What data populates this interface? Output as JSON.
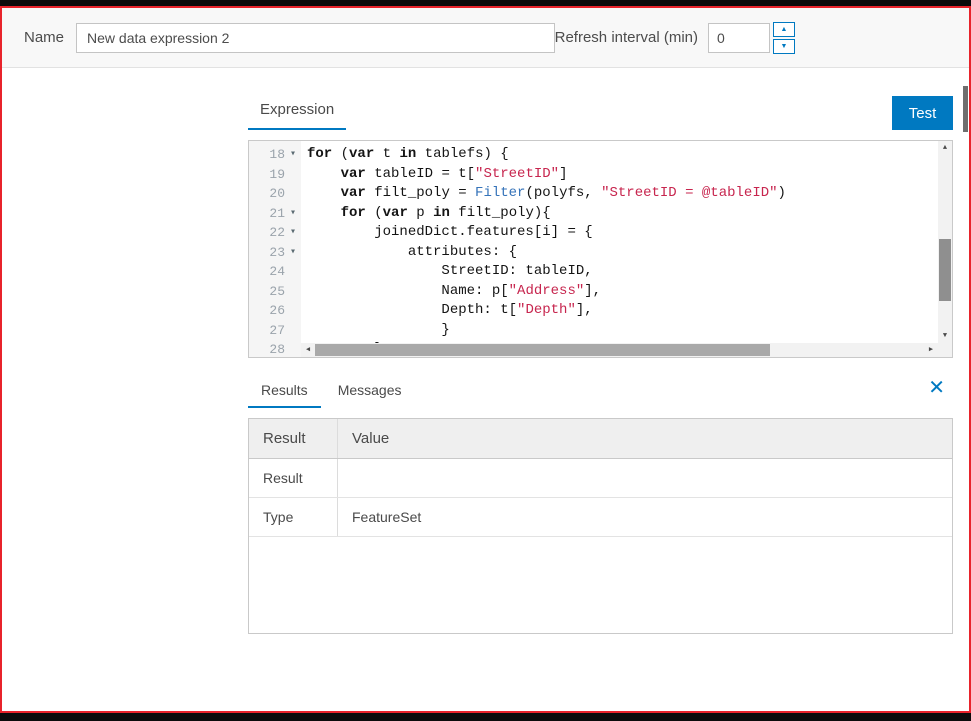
{
  "colors": {
    "accent": "#0079c1",
    "frame_border": "#e8232b",
    "code_string": "#c7254e",
    "code_function": "#3573b9"
  },
  "icons": {
    "fold": "▾",
    "scroll_up": "▲",
    "scroll_down": "▼",
    "scroll_left": "◀",
    "scroll_right": "▶",
    "spinner_up": "▲",
    "spinner_down": "▼",
    "close": "✕"
  },
  "header": {
    "name_label": "Name",
    "name_value": "New data expression 2",
    "refresh_label": "Refresh interval (min)",
    "refresh_value": "0"
  },
  "expression_panel": {
    "tab": "Expression",
    "test_button": "Test",
    "editor": {
      "first_line_number": 18,
      "lines": [
        {
          "num": 18,
          "fold": true,
          "segs": [
            [
              "k",
              "for"
            ],
            [
              "p",
              " ("
            ],
            [
              "k",
              "var"
            ],
            [
              "p",
              " t "
            ],
            [
              "k",
              "in"
            ],
            [
              "p",
              " tablefs) {"
            ]
          ]
        },
        {
          "num": 19,
          "fold": false,
          "segs": [
            [
              "p",
              "    "
            ],
            [
              "k",
              "var"
            ],
            [
              "p",
              " tableID = t["
            ],
            [
              "s",
              "\"StreetID\""
            ],
            [
              "p",
              "]"
            ]
          ]
        },
        {
          "num": 20,
          "fold": false,
          "segs": [
            [
              "p",
              "    "
            ],
            [
              "k",
              "var"
            ],
            [
              "p",
              " filt_poly = "
            ],
            [
              "f",
              "Filter"
            ],
            [
              "p",
              "(polyfs, "
            ],
            [
              "s",
              "\"StreetID = @tableID\""
            ],
            [
              "p",
              ")"
            ]
          ]
        },
        {
          "num": 21,
          "fold": true,
          "segs": [
            [
              "p",
              "    "
            ],
            [
              "k",
              "for"
            ],
            [
              "p",
              " ("
            ],
            [
              "k",
              "var"
            ],
            [
              "p",
              " p "
            ],
            [
              "k",
              "in"
            ],
            [
              "p",
              " filt_poly){"
            ]
          ]
        },
        {
          "num": 22,
          "fold": true,
          "segs": [
            [
              "p",
              "        joinedDict.features[i] = {"
            ]
          ]
        },
        {
          "num": 23,
          "fold": true,
          "segs": [
            [
              "p",
              "            attributes: {"
            ]
          ]
        },
        {
          "num": 24,
          "fold": false,
          "segs": [
            [
              "p",
              "                StreetID: tableID,"
            ]
          ]
        },
        {
          "num": 25,
          "fold": false,
          "segs": [
            [
              "p",
              "                Name: p["
            ],
            [
              "s",
              "\"Address\""
            ],
            [
              "p",
              "],"
            ]
          ]
        },
        {
          "num": 26,
          "fold": false,
          "segs": [
            [
              "p",
              "                Depth: t["
            ],
            [
              "s",
              "\"Depth\""
            ],
            [
              "p",
              "],"
            ]
          ]
        },
        {
          "num": 27,
          "fold": false,
          "segs": [
            [
              "p",
              "                }"
            ]
          ]
        },
        {
          "num": 28,
          "fold": false,
          "segs": [
            [
              "p",
              "        }"
            ]
          ]
        }
      ]
    }
  },
  "results_panel": {
    "tabs": [
      {
        "label": "Results",
        "active": true
      },
      {
        "label": "Messages",
        "active": false
      }
    ],
    "table": {
      "headers": [
        "Result",
        "Value"
      ],
      "rows": [
        {
          "label": "Result",
          "value": ""
        },
        {
          "label": "Type",
          "value": "FeatureSet"
        }
      ]
    }
  }
}
